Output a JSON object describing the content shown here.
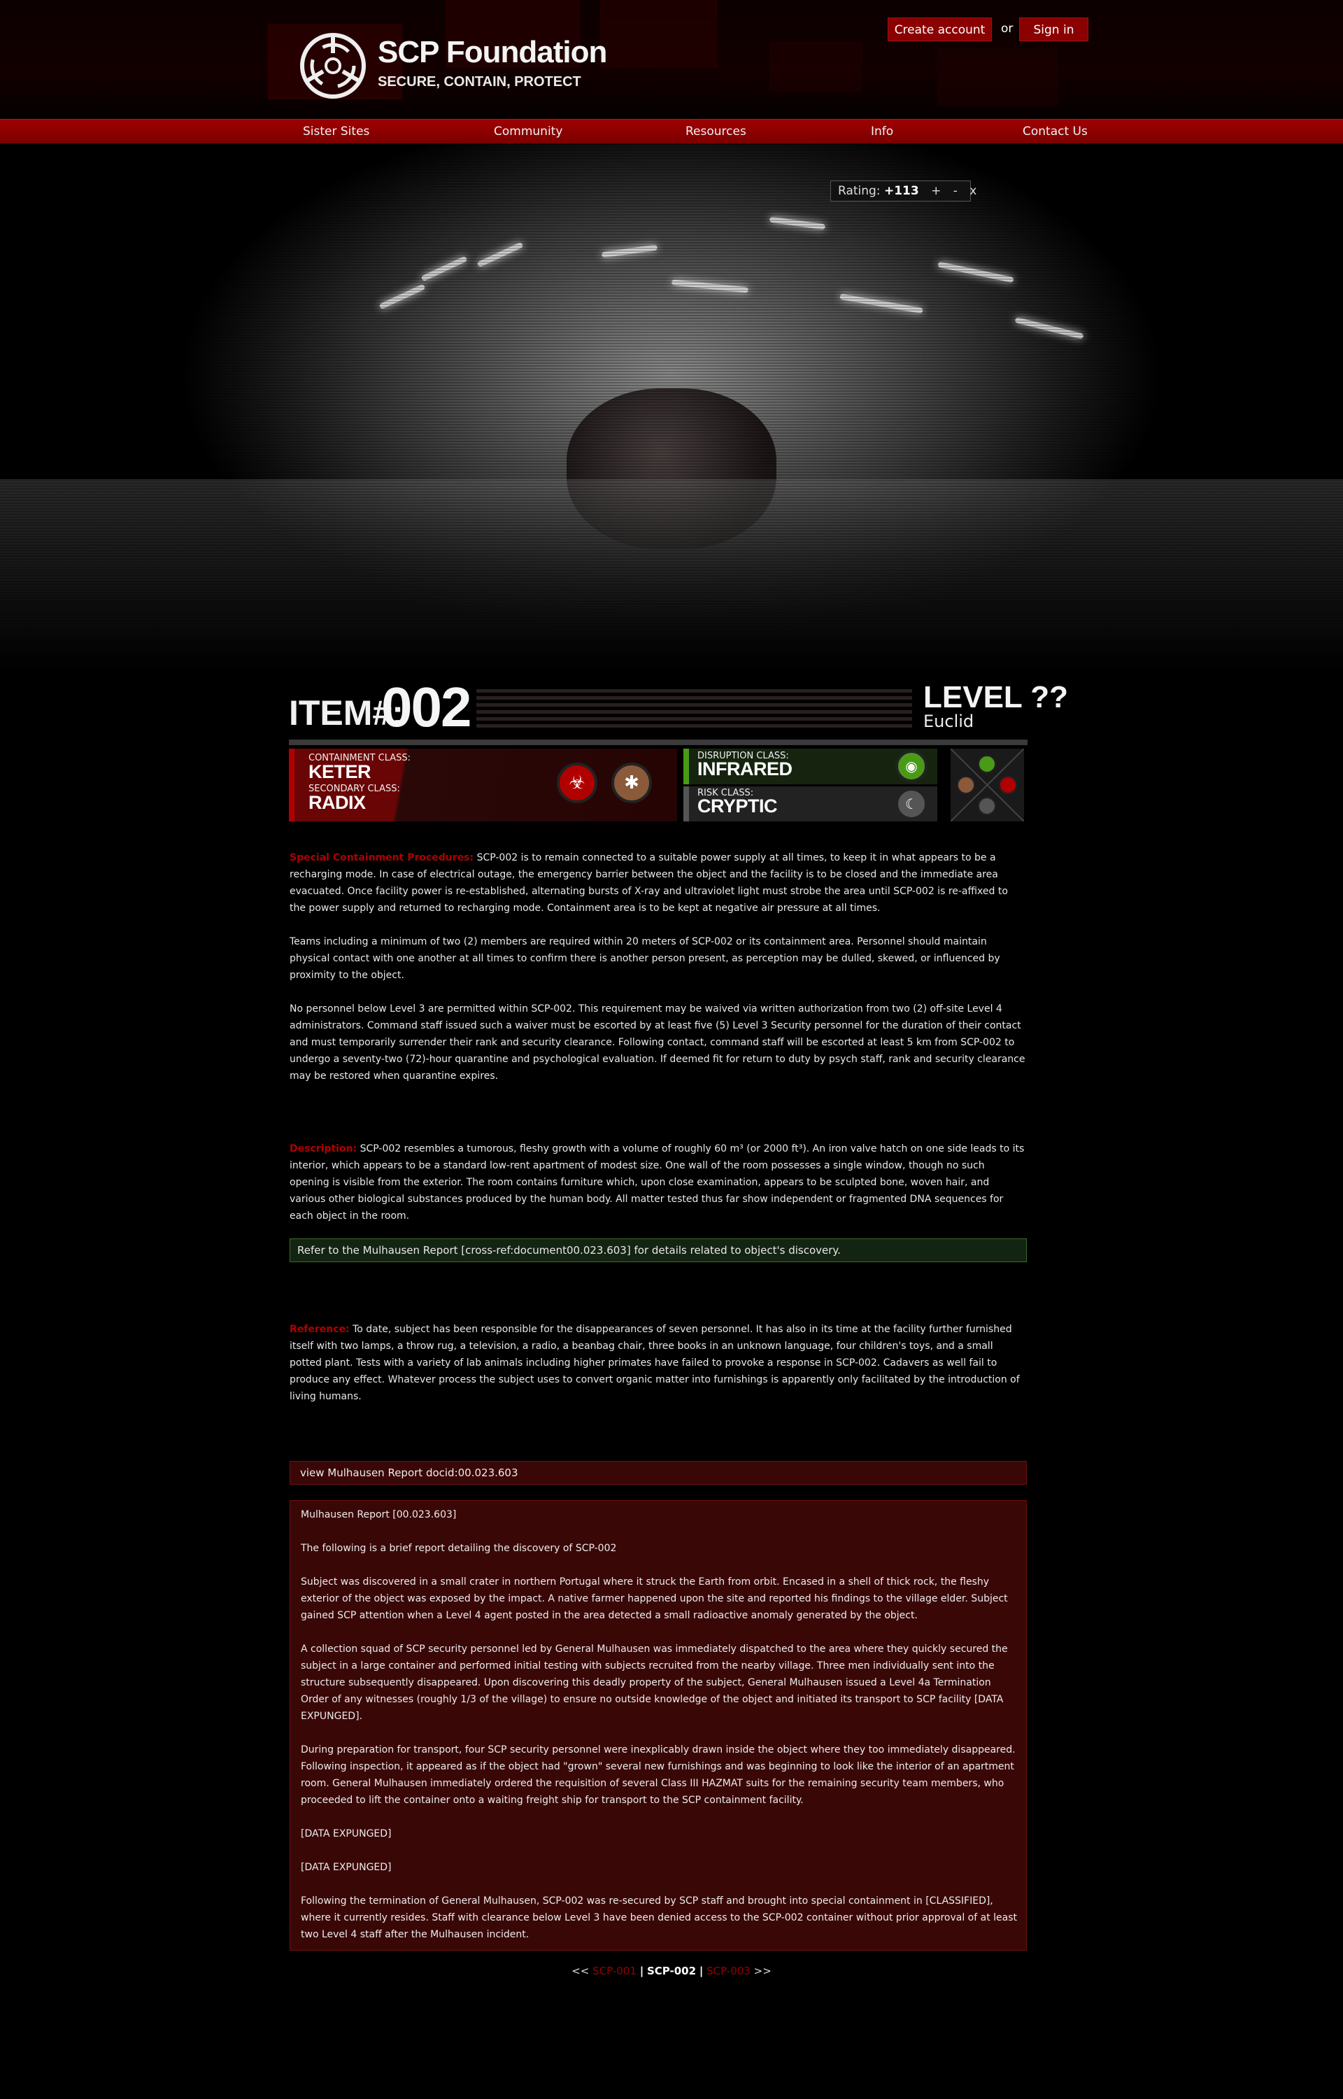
{
  "header": {
    "site_title": "SCP Foundation",
    "site_tagline": "SECURE, CONTAIN, PROTECT",
    "create_account": "Create account",
    "or_text": "or",
    "sign_in": "Sign in"
  },
  "nav": [
    "Sister Sites",
    "Community",
    "Resources",
    "Info",
    "Contact Us"
  ],
  "rating": {
    "label": "Rating:",
    "value": "+113",
    "plus": "+",
    "minus": "-",
    "cancel": "x"
  },
  "item": {
    "label": "ITEM#:",
    "number": "002",
    "level": "LEVEL ??",
    "object_class": "Euclid"
  },
  "classes": {
    "containment_label": "CONTAINMENT CLASS:",
    "containment_value": "KETER",
    "secondary_label": "SECONDARY CLASS:",
    "secondary_value": "RADIX",
    "disruption_label": "DISRUPTION CLASS:",
    "disruption_value": "INFRARED",
    "risk_label": "RISK CLASS:",
    "risk_value": "CRYPTIC",
    "colors": {
      "keter": "#b00000",
      "radix": "#8a5a3a",
      "infrared": "#4a9a18",
      "cryptic": "#555555"
    }
  },
  "sections": {
    "procedures_title": "Special Containment Procedures:",
    "procedures_1": "SCP-002 is to remain connected to a suitable power supply at all times, to keep it in what appears to be a recharging mode. In case of electrical outage, the emergency barrier between the object and the facility is to be closed and the immediate area evacuated. Once facility power is re-established, alternating bursts of X-ray and ultraviolet light must strobe the area until SCP-002 is re-affixed to the power supply and returned to recharging mode. Containment area is to be kept at negative air pressure at all times.",
    "procedures_2": "Teams including a minimum of two (2) members are required within 20 meters of SCP-002 or its containment area. Personnel should maintain physical contact with one another at all times to confirm there is another person present, as perception may be dulled, skewed, or influenced by proximity to the object.",
    "procedures_3": "No personnel below Level 3 are permitted within SCP-002. This requirement may be waived via written authorization from two (2) off-site Level 4 administrators. Command staff issued such a waiver must be escorted by at least five (5) Level 3 Security personnel for the duration of their contact and must temporarily surrender their rank and security clearance. Following contact, command staff will be escorted at least 5 km from SCP-002 to undergo a seventy-two (72)-hour quarantine and psychological evaluation. If deemed fit for return to duty by psych staff, rank and security clearance may be restored when quarantine expires.",
    "description_title": "Description:",
    "description": "SCP-002 resembles a tumorous, fleshy growth with a volume of roughly 60 m³ (or 2000 ft³). An iron valve hatch on one side leads to its interior, which appears to be a standard low-rent apartment of modest size. One wall of the room possesses a single window, though no such opening is visible from the exterior. The room contains furniture which, upon close examination, appears to be sculpted bone, woven hair, and various other biological substances produced by the human body. All matter tested thus far show independent or fragmented DNA sequences for each object in the room.",
    "refer_note": "Refer to the Mulhausen Report [cross-ref:document00.023.603] for details related to object's discovery.",
    "reference_title": "Reference:",
    "reference": "To date, subject has been responsible for the disappearances of seven personnel. It has also in its time at the facility further furnished itself with two lamps, a throw rug, a television, a radio, a beanbag chair, three books in an unknown language, four children's toys, and a small potted plant. Tests with a variety of lab animals including higher primates have failed to provoke a response in SCP-002. Cadavers as well fail to produce any effect. Whatever process the subject uses to convert organic matter into furnishings is apparently only facilitated by the introduction of living humans."
  },
  "report": {
    "toggle": "view Mulhausen Report docid:00.023.603",
    "title": "Mulhausen Report [00.023.603]",
    "intro": "The following is a brief report detailing the discovery of SCP-002",
    "p1": "Subject was discovered in a small crater in northern Portugal where it struck the Earth from orbit. Encased in a shell of thick rock, the fleshy exterior of the object was exposed by the impact. A native farmer happened upon the site and reported his findings to the village elder. Subject gained SCP attention when a Level 4 agent posted in the area detected a small radioactive anomaly generated by the object.",
    "p2": "A collection squad of SCP security personnel led by General Mulhausen was immediately dispatched to the area where they quickly secured the subject in a large container and performed initial testing with subjects recruited from the nearby village. Three men individually sent into the structure subsequently disappeared. Upon discovering this deadly property of the subject, General Mulhausen issued a Level 4a Termination Order of any witnesses (roughly 1/3 of the village) to ensure no outside knowledge of the object and initiated its transport to SCP facility [DATA EXPUNGED].",
    "p3": "During preparation for transport, four SCP security personnel were inexplicably drawn inside the object where they too immediately disappeared. Following inspection, it appeared as if the object had \"grown\" several new furnishings and was beginning to look like the interior of an apartment room. General Mulhausen immediately ordered the requisition of several Class III HAZMAT suits for the remaining security team members, who proceeded to lift the container onto a waiting freight ship for transport to the SCP containment facility.",
    "expunged_1": "[DATA EXPUNGED]",
    "expunged_2": "[DATA EXPUNGED]",
    "p4": "Following the termination of General Mulhausen, SCP-002 was re-secured by SCP staff and brought into special containment in [CLASSIFIED], where it currently resides. Staff with clearance below Level 3 have been denied access to the SCP-002 container without prior approval of at least two Level 4 staff after the Mulhausen incident."
  },
  "footer_nav": {
    "prev_arrow": "<<",
    "prev": "SCP-001",
    "sep1": "|",
    "current": "SCP-002",
    "sep2": "|",
    "next": "SCP-003",
    "next_arrow": ">>"
  }
}
